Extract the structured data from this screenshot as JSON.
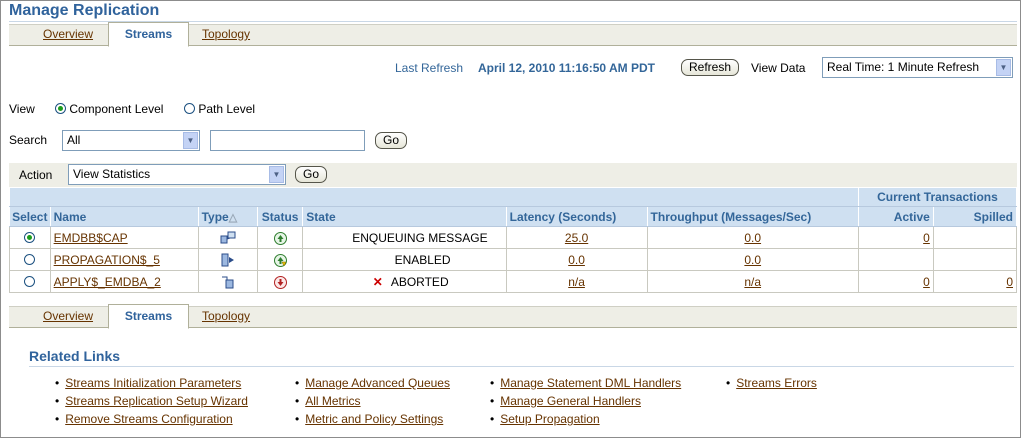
{
  "page": {
    "title": "Manage Replication"
  },
  "tabs": [
    {
      "label": "Overview"
    },
    {
      "label": "Streams"
    },
    {
      "label": "Topology"
    }
  ],
  "refresh": {
    "label": "Last Refresh",
    "value": "April 12, 2010 11:16:50 AM PDT",
    "button": "Refresh",
    "view_data_label": "View Data",
    "view_data_value": "Real Time: 1 Minute Refresh"
  },
  "view": {
    "label": "View",
    "options": [
      {
        "label": "Component Level",
        "selected": true
      },
      {
        "label": "Path Level",
        "selected": false
      }
    ]
  },
  "search": {
    "label": "Search",
    "select_value": "All",
    "input_value": "",
    "go": "Go"
  },
  "action": {
    "label": "Action",
    "select_value": "View Statistics",
    "go": "Go"
  },
  "table": {
    "group_header": "Current Transactions",
    "columns": {
      "select": "Select",
      "name": "Name",
      "type": "Type",
      "status": "Status",
      "state": "State",
      "latency": "Latency (Seconds)",
      "throughput": "Throughput (Messages/Sec)",
      "active": "Active",
      "spilled": "Spilled"
    },
    "rows": [
      {
        "selected": true,
        "name": "EMDBB$CAP",
        "type_icon": "capture-icon",
        "status_icon": "status-up-icon",
        "state": "ENQUEUING MESSAGE",
        "latency": "25.0",
        "throughput": "0.0",
        "active": "0",
        "spilled": ""
      },
      {
        "selected": false,
        "name": "PROPAGATION$_5",
        "type_icon": "propagation-icon",
        "status_icon": "status-up-warning-icon",
        "state": "ENABLED",
        "latency": "0.0",
        "throughput": "0.0",
        "active": "",
        "spilled": ""
      },
      {
        "selected": false,
        "name": "APPLY$_EMDBA_2",
        "type_icon": "apply-icon",
        "status_icon": "status-down-icon",
        "state": "ABORTED",
        "latency": "n/a",
        "throughput": "n/a",
        "active": "0",
        "spilled": "0"
      }
    ]
  },
  "related": {
    "title": "Related Links",
    "col1": [
      "Streams Initialization Parameters",
      "Streams Replication Setup Wizard",
      "Remove Streams Configuration"
    ],
    "col2": [
      "Manage Advanced Queues",
      "All Metrics",
      "Metric and Policy Settings"
    ],
    "col3": [
      "Manage Statement DML Handlers",
      "Manage General Handlers",
      "Setup Propagation"
    ],
    "col4": [
      "Streams Errors"
    ]
  },
  "colors": {
    "accent": "#30639c",
    "link": "#663300",
    "header_bg": "#cfe0f1",
    "tab_bg": "#eeeee6"
  }
}
